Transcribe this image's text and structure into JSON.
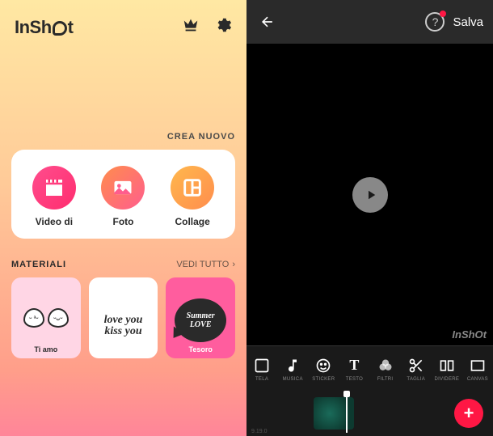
{
  "editor": {
    "save_label": "Salva",
    "watermark": "InShOt",
    "version": "9.19.0",
    "help_symbol": "?",
    "add_symbol": "+",
    "tools": [
      {
        "label": "TELA"
      },
      {
        "label": "MUSICA"
      },
      {
        "label": "STICKER"
      },
      {
        "label": "TESTO"
      },
      {
        "label": "FILTRI"
      },
      {
        "label": "TAGLIA"
      },
      {
        "label": "DIVIDERE"
      },
      {
        "label": "CANVAS"
      }
    ]
  },
  "home": {
    "brand_prefix": "InSh",
    "brand_suffix": "t",
    "create_label": "CREA NUOVO",
    "items": [
      {
        "label": "Video di"
      },
      {
        "label": "Foto"
      },
      {
        "label": "Collage"
      }
    ],
    "materials_label": "MATERIALI",
    "see_all_label": "VEDI TUTTO",
    "see_all_chevron": "›",
    "materials": [
      {
        "label": "Ti amo"
      },
      {
        "label": "",
        "art_text": "love\nyou\nkiss you"
      },
      {
        "label": "Tesoro",
        "art_text": "Summer\nLOVE"
      }
    ]
  }
}
